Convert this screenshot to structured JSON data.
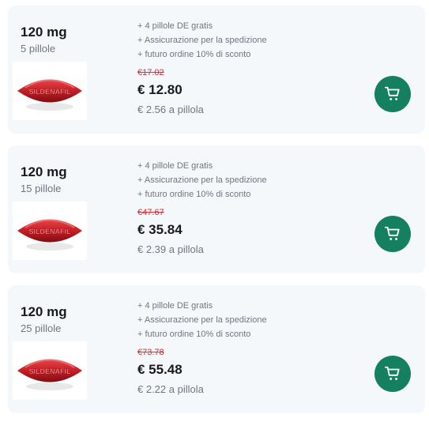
{
  "offers": [
    {
      "dose": "120 mg",
      "count": "5 pillole",
      "pill_text": "SILDENAFIL",
      "perks": [
        "+ 4 pillole DE gratis",
        "+ Assicurazione per la spedizione",
        "+ futuro ordine 10% di sconto"
      ],
      "old_price": "€17.02",
      "price": "€ 12.80",
      "unit_price": "€ 2.56 a pillola"
    },
    {
      "dose": "120 mg",
      "count": "15 pillole",
      "pill_text": "SILDENAFIL",
      "perks": [
        "+ 4 pillole DE gratis",
        "+ Assicurazione per la spedizione",
        "+ futuro ordine 10% di sconto"
      ],
      "old_price": "€47.67",
      "price": "€ 35.84",
      "unit_price": "€ 2.39 a pillola"
    },
    {
      "dose": "120 mg",
      "count": "25 pillole",
      "pill_text": "SILDENAFIL",
      "perks": [
        "+ 4 pillole DE gratis",
        "+ Assicurazione per la spedizione",
        "+ futuro ordine 10% di sconto"
      ],
      "old_price": "€73.78",
      "price": "€ 55.48",
      "unit_price": "€ 2.22 a pillola"
    }
  ],
  "icons": {
    "cart": "shopping-cart-icon"
  },
  "colors": {
    "accent": "#15805f",
    "strike": "#d0303a",
    "card_bg": "#f5f8fb"
  }
}
